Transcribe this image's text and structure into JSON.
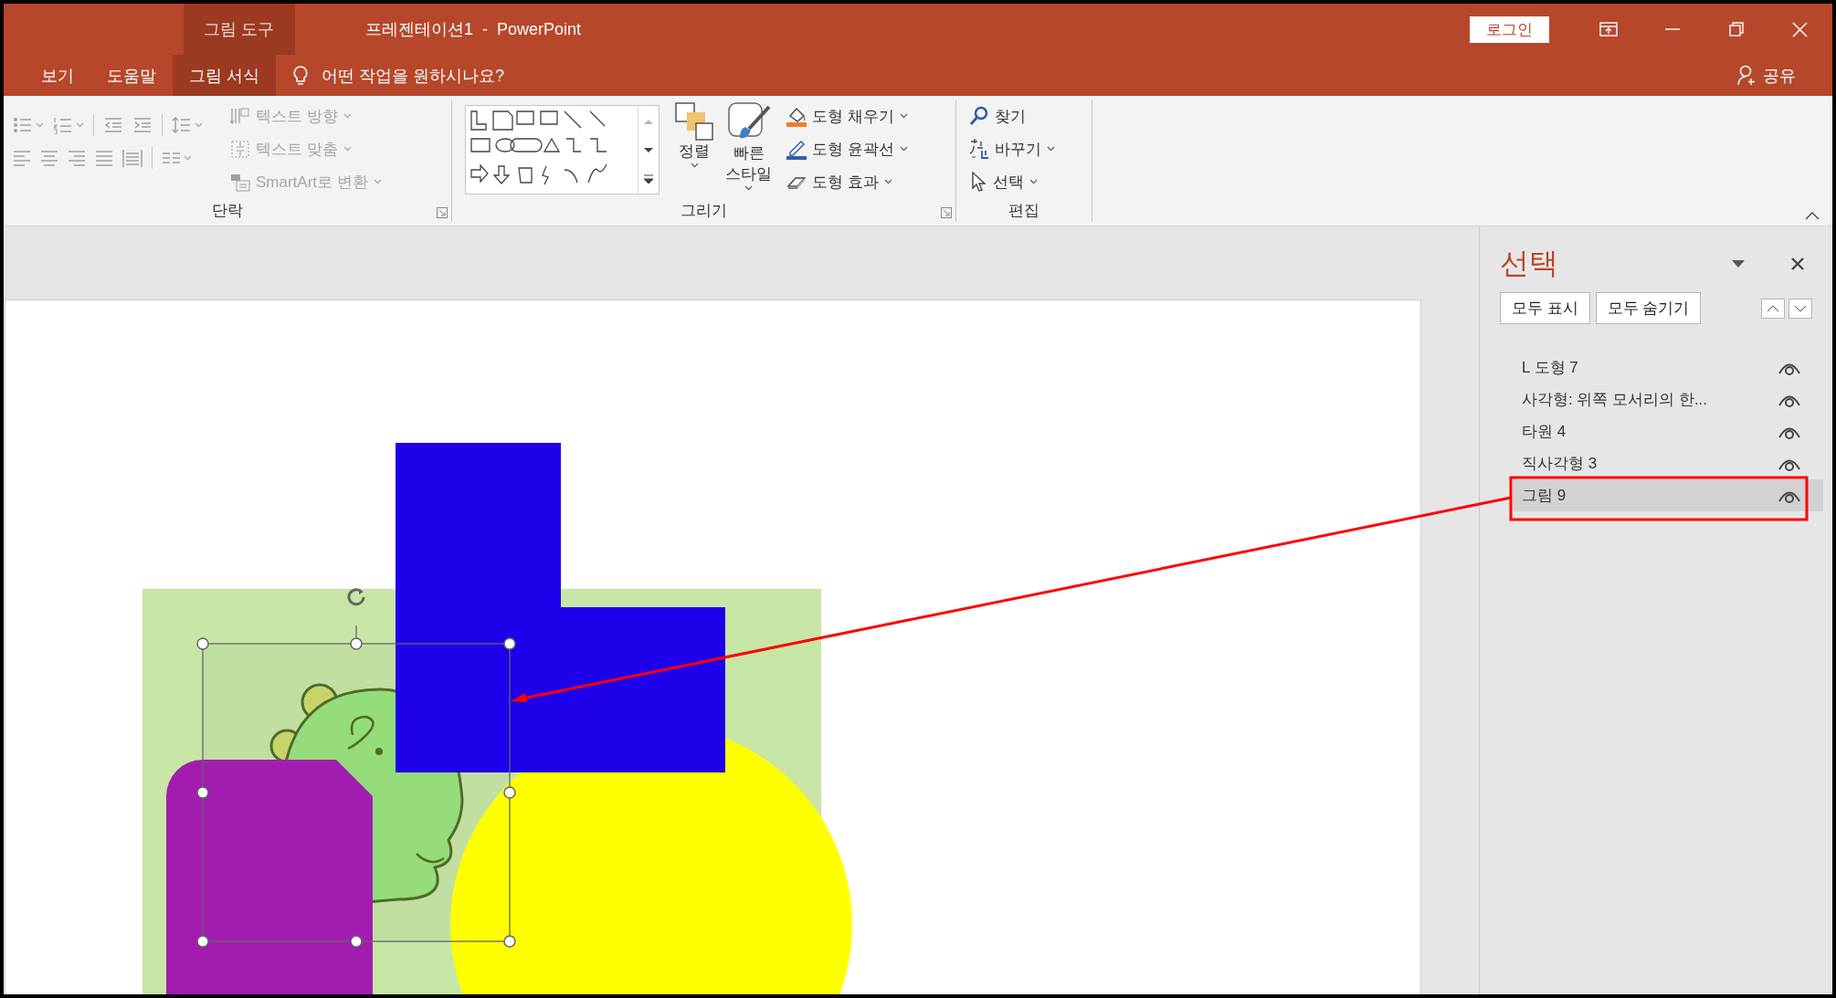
{
  "window": {
    "context_group": "그림 도구",
    "title": "프레젠테이션1  -  PowerPoint",
    "login_button": "로그인"
  },
  "tabs": [
    {
      "label": "보기",
      "selected": false
    },
    {
      "label": "도움말",
      "selected": false
    },
    {
      "label": "그림 서식",
      "selected": true
    }
  ],
  "tell_me": "어떤 작업을 원하시나요?",
  "share_button": "공유",
  "ribbon_groups": [
    {
      "label": "단락",
      "launcher": true,
      "commands": [
        {
          "kind": "small",
          "label": "텍스트 방향",
          "disabled": true,
          "dropdown": true
        },
        {
          "kind": "small",
          "label": "텍스트 맞춤",
          "disabled": true,
          "dropdown": true
        },
        {
          "kind": "small",
          "label": "SmartArt로 변환",
          "disabled": true,
          "dropdown": true
        }
      ]
    },
    {
      "label": "그리기",
      "launcher": true,
      "commands": [
        {
          "kind": "large",
          "label": "정렬",
          "disabled": false,
          "dropdown": true
        },
        {
          "kind": "large",
          "label": "빠른\n스타일",
          "disabled": false,
          "dropdown": true
        },
        {
          "kind": "small",
          "label": "도형 채우기",
          "disabled": false,
          "dropdown": true
        },
        {
          "kind": "small",
          "label": "도형 윤곽선",
          "disabled": false,
          "dropdown": true
        },
        {
          "kind": "small",
          "label": "도형 효과",
          "disabled": false,
          "dropdown": true
        }
      ]
    },
    {
      "label": "편집",
      "launcher": false,
      "commands": [
        {
          "kind": "small",
          "label": "찾기",
          "disabled": false,
          "dropdown": false
        },
        {
          "kind": "small",
          "label": "바꾸기",
          "disabled": false,
          "dropdown": true
        },
        {
          "kind": "small",
          "label": "선택",
          "disabled": false,
          "dropdown": true
        }
      ]
    }
  ],
  "selection_pane": {
    "title": "선택",
    "buttons": [
      "모두 표시",
      "모두 숨기기"
    ],
    "items": [
      {
        "label": "L 도형 7",
        "selected": false,
        "visible": true
      },
      {
        "label": "사각형: 위쪽 모서리의 한...",
        "selected": false,
        "visible": true
      },
      {
        "label": "타원 4",
        "selected": false,
        "visible": true
      },
      {
        "label": "직사각형 3",
        "selected": false,
        "visible": true
      },
      {
        "label": "그림 9",
        "selected": true,
        "visible": true
      }
    ]
  }
}
